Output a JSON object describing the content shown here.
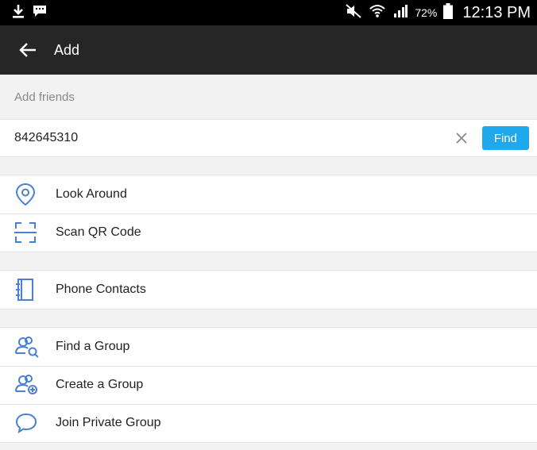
{
  "status_bar": {
    "battery_text": "72%",
    "time": "12:13 PM"
  },
  "app_bar": {
    "title": "Add"
  },
  "add_friends": {
    "section_label": "Add friends",
    "search_value": "842645310",
    "find_label": "Find"
  },
  "menu": {
    "look_around": "Look Around",
    "scan_qr": "Scan QR Code",
    "phone_contacts": "Phone Contacts",
    "find_group": "Find a Group",
    "create_group": "Create a Group",
    "join_private_group": "Join Private Group"
  },
  "colors": {
    "accent": "#1fa9ec",
    "icon": "#4a7fd6",
    "app_bar": "#262626"
  }
}
